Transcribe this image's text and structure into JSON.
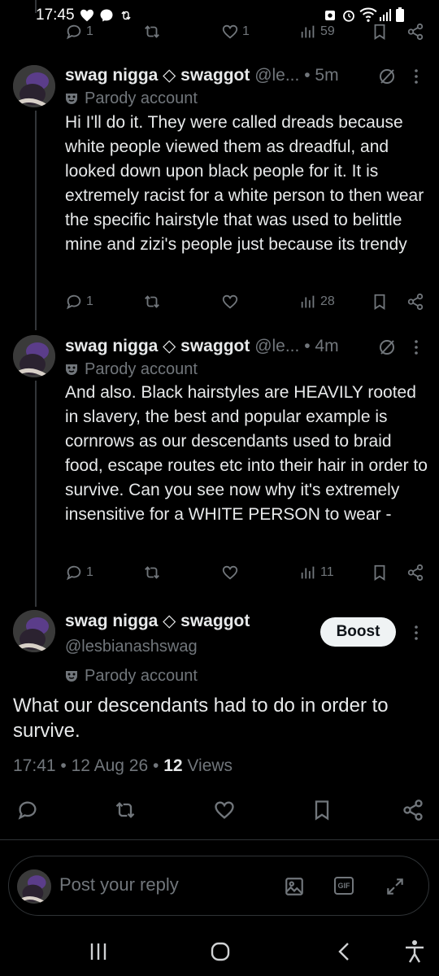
{
  "status_bar": {
    "time": "17:45",
    "icons": [
      "heart-icon",
      "messenger-icon",
      "repost-icon",
      "alarm-icon",
      "wifi-icon",
      "signal-icon",
      "battery-icon"
    ]
  },
  "top_actions": {
    "replies": "1",
    "likes": "1",
    "views": "59"
  },
  "replies": [
    {
      "name": "swag nigga ◇ swaggot",
      "handle": "@le...",
      "time": "• 5m",
      "parody_label": "Parody account",
      "text": "Hi I'll do it. They were called dreads because white people viewed them as dreadful, and looked down upon black people for it. It is extremely racist for a white person to then wear the specific hairstyle that was used to belittle mine and zizi's people just because its trendy",
      "replies": "1",
      "likes": "",
      "views": "28"
    },
    {
      "name": "swag nigga ◇ swaggot",
      "handle": "@le...",
      "time": "• 4m",
      "parody_label": "Parody account",
      "text": "And also. Black hairstyles are HEAVILY rooted in slavery, the best and popular example is cornrows as our descendants used to braid food, escape routes etc into their hair in order to survive. Can you see now why it's extremely insensitive for a WHITE PERSON to wear -",
      "replies": "1",
      "likes": "",
      "views": "11"
    }
  ],
  "main_post": {
    "name": "swag nigga ◇ swaggot",
    "handle": "@lesbianashswag",
    "boost_label": "Boost",
    "parody_label": "Parody account",
    "text": "What our descendants had to do in order to survive.",
    "timestamp": "17:41 • 12 Aug 26 •",
    "views_count": "12",
    "views_label": "Views"
  },
  "reply_box": {
    "placeholder": "Post your reply",
    "gif_label": "GIF"
  },
  "colors": {
    "background": "#000000",
    "text": "#e7e9ea",
    "muted": "#71767b",
    "border": "#2f3336",
    "boost_bg": "#eff3f4"
  }
}
